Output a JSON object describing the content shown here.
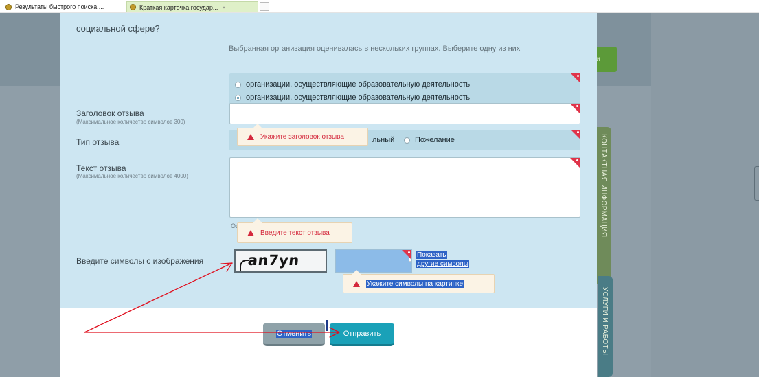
{
  "browser": {
    "tabs": [
      {
        "label": "Результаты быстрого поиска ..."
      },
      {
        "label": "Краткая карточка государ...",
        "close": "×"
      }
    ]
  },
  "background": {
    "green_button_label": "и",
    "side_tabs": [
      {
        "label": "КОНТАКТНАЯ ИНФОРМАЦИЯ"
      },
      {
        "label": "УСЛУГИ И РАБОТЫ"
      }
    ]
  },
  "form": {
    "question_tail": "социальной сфере?",
    "group_hint": "Выбранная организация оценивалась в нескольких группах. Выберите одну из них",
    "groups": [
      {
        "label": "организации, осуществляющие образовательную деятельность",
        "selected": false
      },
      {
        "label": "организации, осуществляющие образовательную деятельность",
        "selected": true
      }
    ],
    "title_field": {
      "label": "Заголовок отзыва",
      "sub": "(Максимальное количество символов 300)",
      "value": "",
      "error": "Укажите заголовок отзыва"
    },
    "type_field": {
      "label": "Тип отзыва",
      "options": [
        {
          "label": "льный"
        },
        {
          "label": "Пожелание"
        }
      ]
    },
    "text_field": {
      "label": "Текст отзыва",
      "sub": "(Максимальное количество символов 4000)",
      "value": "",
      "counter_fragment": "Ос",
      "error": "Введите текст отзыва"
    },
    "captcha": {
      "label": "Введите символы с изображения",
      "image_text": "an7yn",
      "value": "",
      "show_link_line1": "Показать",
      "show_link_line2": "другие символы",
      "error": "Укажите символы на картинке"
    },
    "buttons": {
      "cancel": "Отменить",
      "submit": "Отправить"
    }
  },
  "annotations": {
    "arrow_color": "#e0101f"
  }
}
